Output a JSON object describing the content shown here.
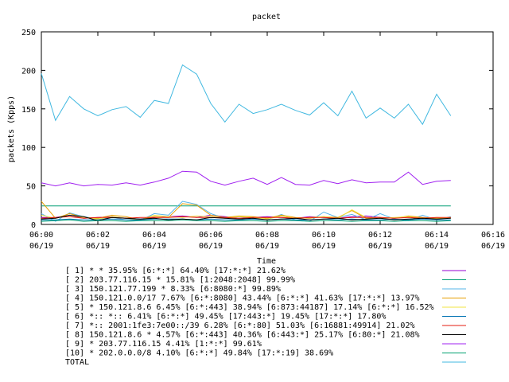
{
  "chart_data": {
    "type": "line",
    "title": "packet",
    "xlabel": "Time",
    "ylabel": "packets (Kpps)",
    "ylim": [
      0,
      250
    ],
    "xlim": [
      "2021-06-19 06:00",
      "2021-06-19 06:16"
    ],
    "yticks": [
      "0",
      "50",
      "100",
      "150",
      "200",
      "250"
    ],
    "xticks": [
      {
        "time": "06:00",
        "date": "06/19"
      },
      {
        "time": "06:02",
        "date": "06/19"
      },
      {
        "time": "06:04",
        "date": "06/19"
      },
      {
        "time": "06:06",
        "date": "06/19"
      },
      {
        "time": "06:08",
        "date": "06/19"
      },
      {
        "time": "06:10",
        "date": "06/19"
      },
      {
        "time": "06:12",
        "date": "06/19"
      },
      {
        "time": "06:14",
        "date": "06/19"
      },
      {
        "time": "06:16",
        "date": "06/19"
      }
    ],
    "grid": false,
    "legend_position": "bottom",
    "x": [
      "06:00",
      "06:00:30",
      "06:01",
      "06:01:30",
      "06:02",
      "06:02:30",
      "06:03",
      "06:03:30",
      "06:04",
      "06:04:30",
      "06:05",
      "06:05:30",
      "06:06",
      "06:06:30",
      "06:07",
      "06:07:30",
      "06:08",
      "06:08:30",
      "06:09",
      "06:09:30",
      "06:10",
      "06:10:30",
      "06:11",
      "06:11:30",
      "06:12",
      "06:12:30",
      "06:13",
      "06:13:30",
      "06:14",
      "06:14:30"
    ],
    "series": [
      {
        "name": "[ 1] * * 35.95%  [6:*:*] 64.40% [17:*:*] 21.62%",
        "color": "#9400d3",
        "values": [
          9,
          9,
          12,
          8,
          9,
          10,
          8,
          7,
          9,
          10,
          11,
          9,
          12,
          10,
          8,
          9,
          10,
          9,
          8,
          10,
          9,
          8,
          10,
          11,
          9,
          8,
          10,
          9,
          8,
          9
        ]
      },
      {
        "name": "[ 2] 203.77.116.15 * 15.81%  [1:2048:2048] 99.99%",
        "color": "#009e73",
        "values": [
          24,
          24,
          24,
          24,
          24,
          24,
          24,
          24,
          24,
          24,
          24,
          24,
          24,
          24,
          24,
          24,
          24,
          24,
          24,
          24,
          24,
          24,
          24,
          24,
          24,
          24,
          24,
          24,
          24,
          24
        ]
      },
      {
        "name": "[ 3] 150.121.77.199 * 8.33%  [6:8080:*] 99.89%",
        "color": "#56b4e9",
        "values": [
          14,
          4,
          15,
          10,
          7,
          9,
          6,
          5,
          14,
          12,
          30,
          26,
          14,
          8,
          10,
          8,
          6,
          13,
          6,
          4,
          16,
          9,
          13,
          6,
          14,
          7,
          5,
          12,
          6,
          10
        ]
      },
      {
        "name": "[ 4] 150.121.0.0/17 7.67%  [6:*:8080] 43.44% [6:*:*] 41.63% [17:*:*] 13.97%",
        "color": "#e69f00",
        "values": [
          30,
          8,
          14,
          9,
          8,
          12,
          10,
          6,
          10,
          9,
          27,
          25,
          12,
          9,
          11,
          10,
          8,
          12,
          9,
          8,
          10,
          9,
          18,
          8,
          9,
          8,
          11,
          9,
          8,
          9
        ]
      },
      {
        "name": "[ 5] * 150.121.8.6 6.45%  [6:*:443] 38.94% [6:873:44187] 17.14% [6:*:*] 16.52%",
        "color": "#f0e442",
        "values": [
          12,
          8,
          12,
          9,
          7,
          10,
          8,
          6,
          12,
          10,
          9,
          11,
          10,
          8,
          10,
          9,
          7,
          11,
          8,
          9,
          10,
          8,
          19,
          9,
          8,
          9,
          10,
          8,
          9,
          8
        ]
      },
      {
        "name": "[ 6] *:: *:: 6.41%  [6:*:*] 49.45% [17:443:*] 19.45% [17:*:*] 17.80%",
        "color": "#0072b2",
        "values": [
          6,
          6,
          7,
          6,
          6,
          7,
          6,
          6,
          7,
          7,
          7,
          6,
          7,
          6,
          6,
          7,
          6,
          7,
          6,
          6,
          7,
          6,
          7,
          6,
          6,
          7,
          6,
          7,
          6,
          6
        ]
      },
      {
        "name": "[ 7] *:: 2001:1fe3:7e00::/39 6.28%  [6:*:80] 51.03% [6:16881:49914] 21.02%",
        "color": "#e51e10",
        "values": [
          8,
          9,
          10,
          8,
          9,
          9,
          8,
          9,
          9,
          9,
          10,
          9,
          9,
          9,
          8,
          9,
          9,
          9,
          8,
          9,
          9,
          8,
          9,
          9,
          9,
          8,
          9,
          8,
          9,
          9
        ]
      },
      {
        "name": "[ 8] 150.121.8.6 * 4.57%  [6:*:443] 40.36% [6:443:*] 25.17% [6:80:*] 21.08%",
        "color": "#000000",
        "values": [
          7,
          8,
          12,
          10,
          5,
          9,
          8,
          7,
          8,
          6,
          7,
          6,
          9,
          8,
          7,
          8,
          6,
          7,
          8,
          6,
          7,
          8,
          6,
          7,
          8,
          6,
          7,
          8,
          7,
          8
        ]
      },
      {
        "name": "[ 9] * 203.77.116.15 4.41%  [1:*:*] 99.61%",
        "color": "#a020f0",
        "values": [
          54,
          50,
          54,
          50,
          52,
          51,
          54,
          51,
          55,
          60,
          69,
          68,
          56,
          51,
          56,
          60,
          52,
          61,
          52,
          51,
          57,
          53,
          58,
          54,
          55,
          55,
          68,
          52,
          56,
          57
        ]
      },
      {
        "name": "[10] * 202.0.0.0/8 4.10%  [6:*:*] 49.84% [17:*:19] 38.69%",
        "color": "#00a070",
        "values": [
          4,
          5,
          6,
          4,
          5,
          5,
          4,
          5,
          5,
          5,
          6,
          5,
          5,
          4,
          5,
          5,
          4,
          5,
          5,
          4,
          5,
          5,
          4,
          5,
          5,
          4,
          5,
          5,
          4,
          5
        ]
      },
      {
        "name": "TOTAL",
        "color": "#40b8e0",
        "values": [
          196,
          135,
          166,
          150,
          141,
          149,
          153,
          139,
          161,
          157,
          207,
          195,
          157,
          133,
          156,
          144,
          149,
          156,
          148,
          142,
          158,
          141,
          173,
          138,
          151,
          138,
          156,
          130,
          169,
          141
        ]
      }
    ]
  }
}
